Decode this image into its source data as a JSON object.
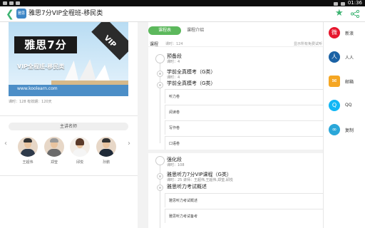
{
  "status_bar": {
    "time": "01:36"
  },
  "app_bar": {
    "logo_text": "雅思",
    "title": "雅思7分VIP全程班-移民类"
  },
  "course_info": {
    "banner": {
      "logo_text": "雅思7分",
      "vip_text": "VIP",
      "slogan": "VIP全程班-移民类",
      "site": "www.koolearn.com"
    },
    "meta": "课时：128    有效期：120天"
  },
  "teachers": {
    "title": "主讲名师",
    "list": [
      {
        "name": "王超伟"
      },
      {
        "name": "郑莹"
      },
      {
        "name": "邱悦"
      },
      {
        "name": "孙鹏"
      }
    ]
  },
  "tabs": [
    {
      "label": "课程表",
      "active": true
    },
    {
      "label": "课程介绍",
      "active": false
    }
  ],
  "course_table": {
    "header": {
      "label": "课程",
      "count": "课时：124",
      "free_note": "显示所有免费试听"
    },
    "sections": [
      {
        "title": "预备段",
        "subtitle": "课时：4",
        "lessons": [
          {
            "title": "学前全真模考（G类）",
            "subtitle": "课时：4"
          },
          {
            "title": "学前全真模考（G类）",
            "subtitle": "",
            "items": [
              "听力卷",
              "阅读卷",
              "写作卷",
              "口语卷"
            ]
          }
        ]
      },
      {
        "title": "强化段",
        "subtitle": "课时：108",
        "lessons": [
          {
            "title": "雅思听力7分VIP课程（G类）",
            "subtitle": "课时：25  讲师：王超伟,王超伟,郑莹,邱悦"
          },
          {
            "title": "雅思听力考试概述",
            "subtitle": "",
            "items": [
              "雅思听力考试概述",
              "雅思听力考试备考"
            ]
          }
        ]
      }
    ]
  },
  "share_panel": [
    {
      "label": "新浪",
      "icon": "weibo-icon",
      "color": "#e6162d",
      "glyph": "微"
    },
    {
      "label": "人人",
      "icon": "renren-icon",
      "color": "#1b62a5",
      "glyph": "人"
    },
    {
      "label": "邮箱",
      "icon": "mail-icon",
      "color": "#f5a623",
      "glyph": "✉"
    },
    {
      "label": "QQ",
      "icon": "qq-icon",
      "color": "#12b7f5",
      "glyph": "Q"
    },
    {
      "label": "复制",
      "icon": "link-icon",
      "color": "#2aa7d9",
      "glyph": "∞"
    }
  ],
  "colors": {
    "accent": "#5cb85c",
    "star": "#3cb371"
  }
}
